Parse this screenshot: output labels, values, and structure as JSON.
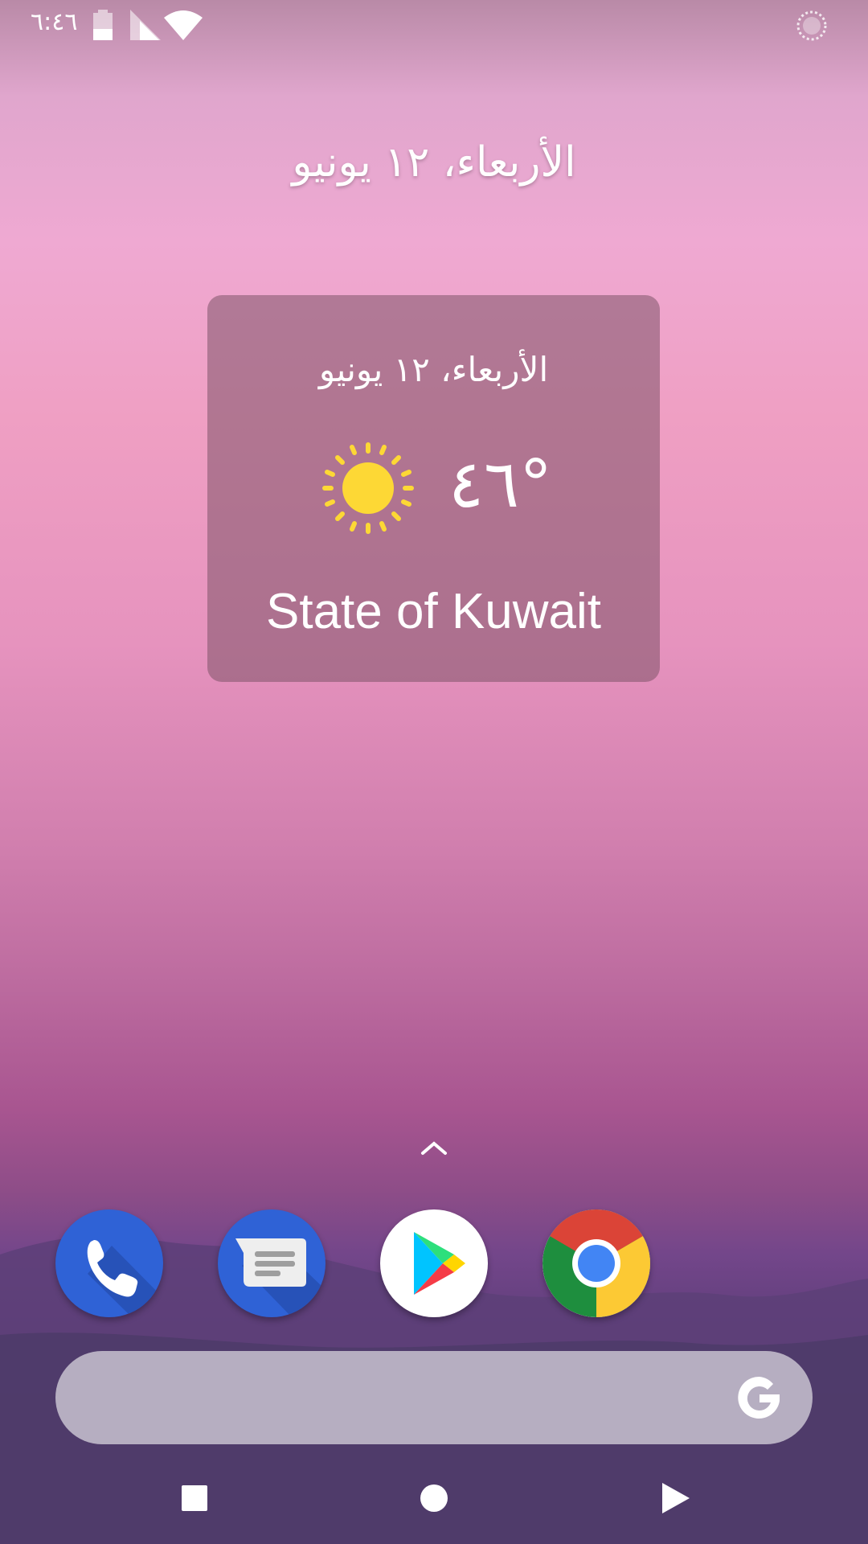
{
  "status_bar": {
    "time": "٦:٤٦",
    "icons": [
      "battery-icon",
      "signal-icon",
      "wifi-icon",
      "sync-icon"
    ]
  },
  "home": {
    "date": "الأربعاء، ١٢ يونيو"
  },
  "weather_widget": {
    "date": "الأربعاء، ١٢ يونيو",
    "condition_icon": "sun-icon",
    "temperature": "°٤٦",
    "location": "State of Kuwait"
  },
  "app_drawer": {
    "icon": "chevron-up-icon"
  },
  "dock": {
    "apps": [
      {
        "name": "Phone",
        "icon": "phone-icon"
      },
      {
        "name": "Messages",
        "icon": "messages-icon"
      },
      {
        "name": "Play Store",
        "icon": "play-store-icon"
      },
      {
        "name": "Chrome",
        "icon": "chrome-icon"
      }
    ]
  },
  "search_bar": {
    "icon": "google-icon"
  },
  "nav_bar": {
    "buttons": [
      "recents-button",
      "home-button",
      "back-button"
    ]
  },
  "colors": {
    "sun": "#fdd835",
    "app_blue": "#2f62d6",
    "chrome_red": "#db4437",
    "chrome_yellow": "#fcc934",
    "chrome_green": "#1e8e3e",
    "chrome_blue": "#4285f4"
  }
}
